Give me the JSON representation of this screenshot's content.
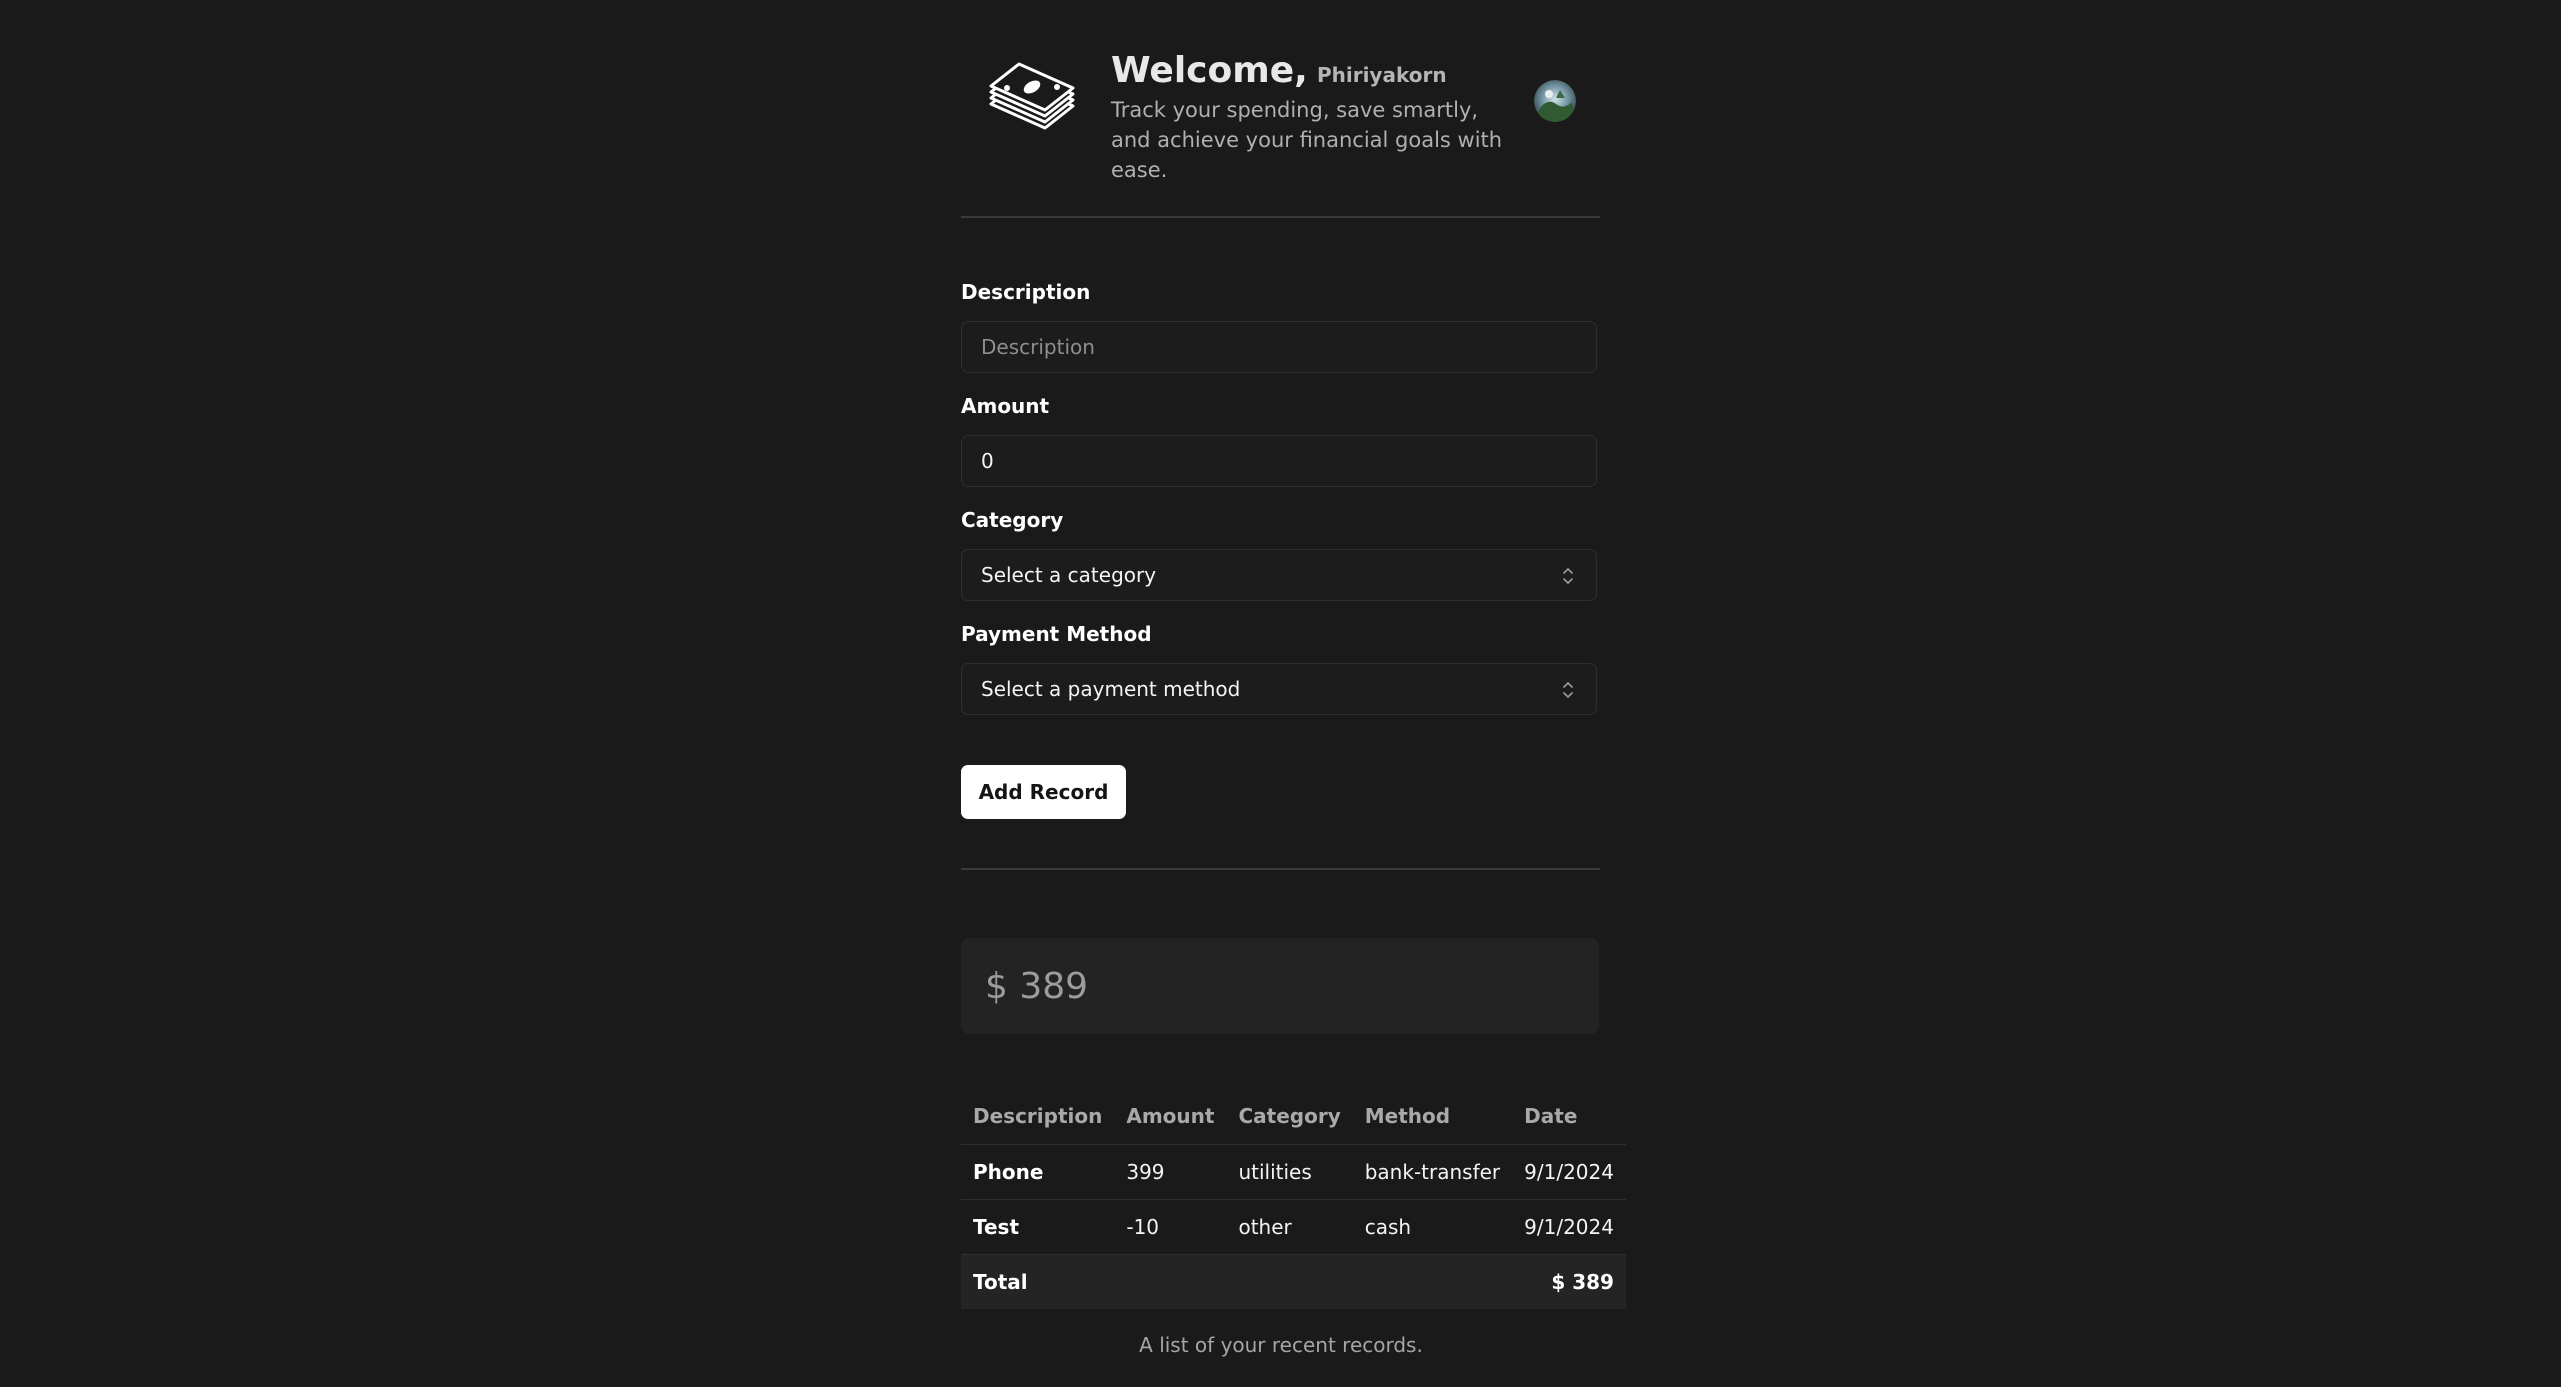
{
  "header": {
    "welcome": "Welcome,",
    "username": "Phiriyakorn",
    "tagline": "Track your spending, save smartly, and achieve your financial goals with ease.",
    "logo_icon": "money-stack-icon",
    "avatar_icon": "user-avatar"
  },
  "form": {
    "description": {
      "label": "Description",
      "placeholder": "Description",
      "value": ""
    },
    "amount": {
      "label": "Amount",
      "value": "0"
    },
    "category": {
      "label": "Category",
      "selected": "Select a category"
    },
    "payment_method": {
      "label": "Payment Method",
      "selected": "Select a payment method"
    },
    "submit_label": "Add Record"
  },
  "summary": {
    "total": "$ 389"
  },
  "table": {
    "columns": [
      "Description",
      "Amount",
      "Category",
      "Method",
      "Date"
    ],
    "rows": [
      [
        "Phone",
        "399",
        "utilities",
        "bank-transfer",
        "9/1/2024"
      ],
      [
        "Test",
        "-10",
        "other",
        "cash",
        "9/1/2024"
      ]
    ],
    "total_label": "Total",
    "total_value": "$ 389",
    "caption": "A list of your recent records."
  },
  "colors": {
    "background": "#1a1a1a",
    "surface": "#232323",
    "border": "#2e2e2e",
    "primary_button": "#ffffff"
  }
}
